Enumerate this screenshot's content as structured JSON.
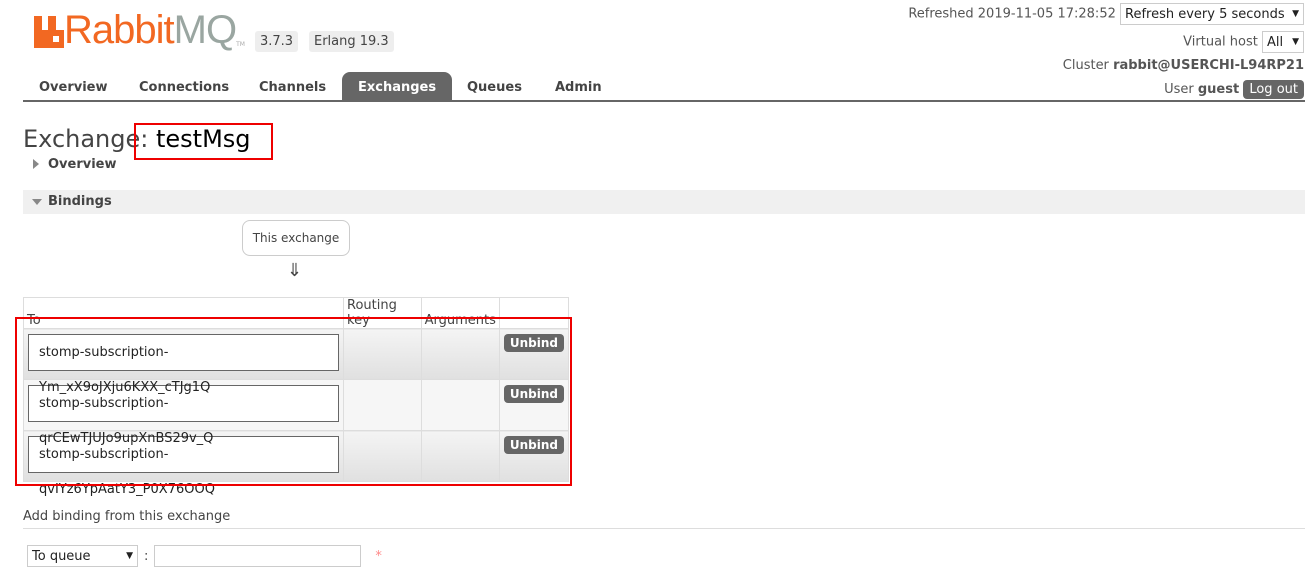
{
  "header": {
    "logo_text_1": "Rabbit",
    "logo_text_2": "MQ",
    "logo_tm": "TM",
    "version": "3.7.3",
    "erlang": "Erlang 19.3",
    "refreshed": "Refreshed 2019-11-05 17:28:52",
    "refresh_select": "Refresh every 5 seconds",
    "vhost_label": "Virtual host",
    "vhost_select": "All",
    "cluster_label": "Cluster",
    "cluster": "rabbit@USERCHI-L94RP21",
    "user_label": "User",
    "user": "guest",
    "logout": "Log out"
  },
  "nav": {
    "tabs": [
      {
        "label": "Overview"
      },
      {
        "label": "Connections"
      },
      {
        "label": "Channels"
      },
      {
        "label": "Exchanges",
        "active": true
      },
      {
        "label": "Queues"
      },
      {
        "label": "Admin"
      }
    ]
  },
  "page": {
    "title_prefix": "Exchange:",
    "title_name": "testMsg",
    "overview": "Overview",
    "bindings": "Bindings",
    "this_exchange": "This exchange",
    "arrow": "⇓",
    "columns": [
      "To",
      "Routing key",
      "Arguments",
      ""
    ],
    "rows": [
      {
        "to": "stomp-subscription-Ym_xX9oJXju6KXX_cTJg1Q",
        "routing_key": "",
        "arguments": "",
        "action": "Unbind"
      },
      {
        "to": "stomp-subscription-qrCEwTJUJo9upXnBS29v_Q",
        "routing_key": "",
        "arguments": "",
        "action": "Unbind"
      },
      {
        "to": "stomp-subscription-qvIYz6YpAatY3_P0X76OOQ",
        "routing_key": "",
        "arguments": "",
        "action": "Unbind"
      }
    ],
    "add_binding": "Add binding from this exchange",
    "dest_type": "To queue",
    "required": "*"
  },
  "colors": {
    "brand_orange": "#f26822",
    "highlight": "#e00000"
  }
}
